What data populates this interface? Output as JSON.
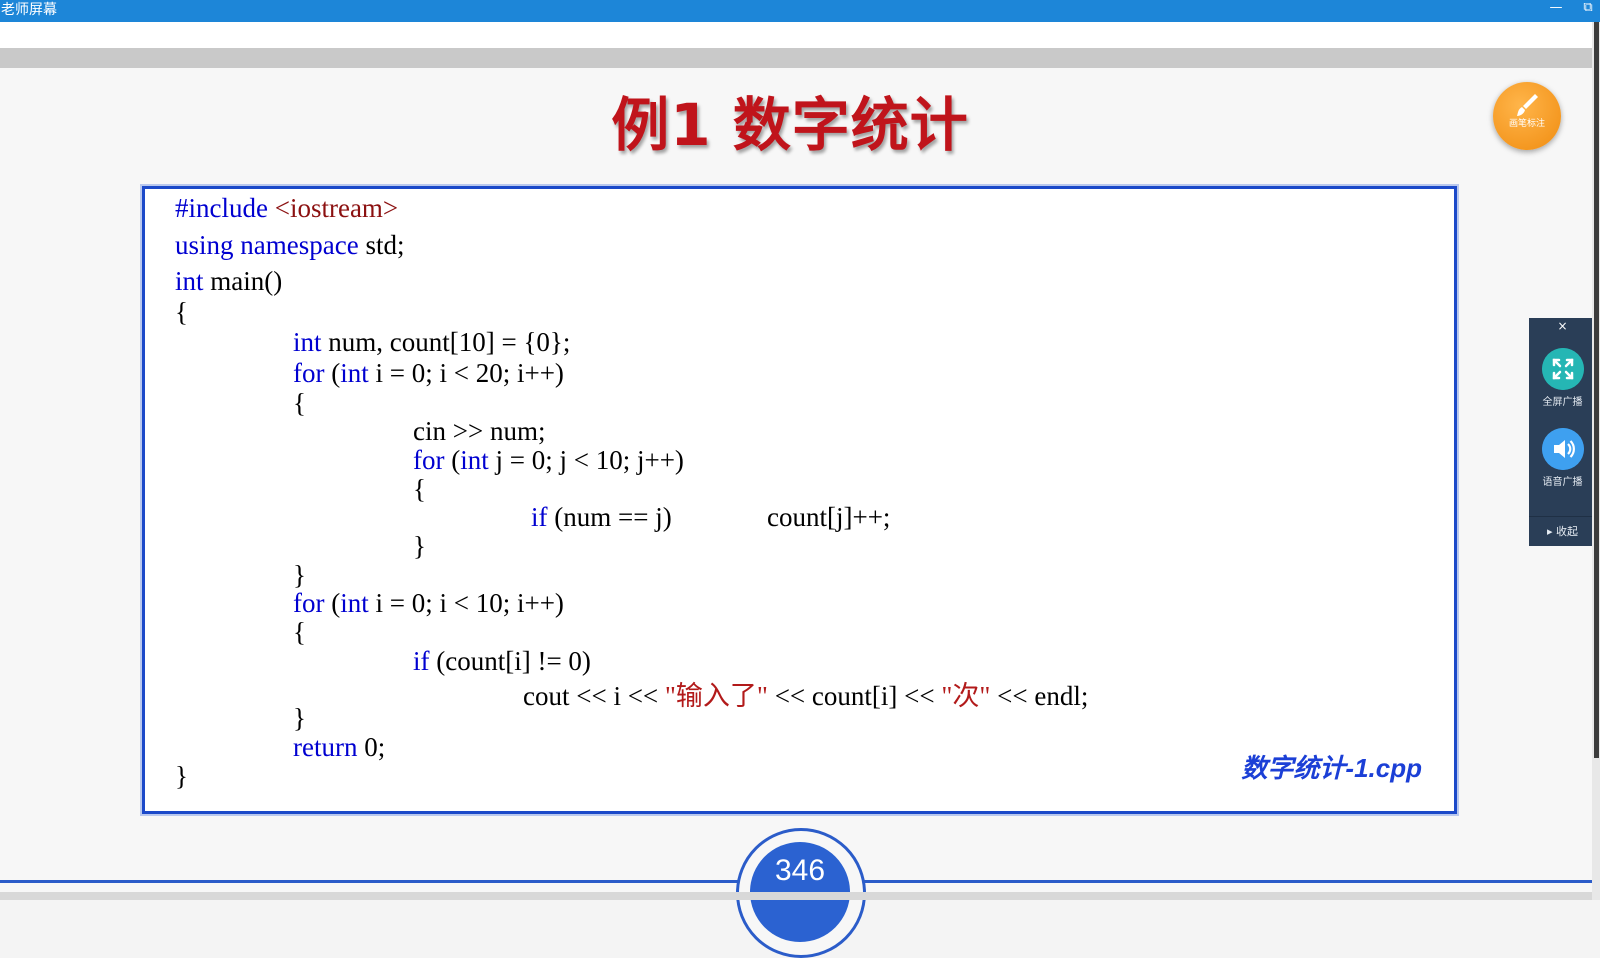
{
  "window": {
    "title": "老师屏幕",
    "minimize": "—",
    "restore": "⧉"
  },
  "slide": {
    "title": "例1 数字统计",
    "filename": "数字统计-1.cpp",
    "page_number": "346",
    "code": {
      "l1_inc": "#include",
      "l1_lib": " <iostream>",
      "l2_kw": "using namespace",
      "l2_rest": " std;",
      "l3_kw": "int",
      "l3_rest": " main()",
      "l4": "{",
      "l5_kw": "int",
      "l5_rest": " num, count[10] = {0};",
      "l6_kw1": "for",
      "l6_a": " (",
      "l6_kw2": "int",
      "l6_b": " i = 0; i < 20; i++)",
      "l7": "{",
      "l8": "cin >> num;",
      "l9_kw1": "for",
      "l9_a": " (",
      "l9_kw2": "int",
      "l9_b": " j = 0; j < 10; j++)",
      "l10": "{",
      "l11_kw": "if",
      "l11_a": " (num == j)",
      "l11_b": "count[j]++;",
      "l12": "}",
      "l13": "}",
      "l14_kw1": "for",
      "l14_a": " (",
      "l14_kw2": "int",
      "l14_b": " i = 0; i < 10; i++)",
      "l15": "{",
      "l16_kw": "if",
      "l16_rest": " (count[i] != 0)",
      "l17_a": "cout << i << ",
      "l17_str1": "\"输入了\"",
      "l17_b": " << count[i] << ",
      "l17_str2": "\"次\"",
      "l17_c": " << endl;",
      "l18": "}",
      "l19_kw": "return",
      "l19_rest": " 0;",
      "l20": "}"
    }
  },
  "pen_button": {
    "label": "画笔标注",
    "icon": "brush-icon"
  },
  "side_panel": {
    "close": "×",
    "fullscreen_label": "全屏广播",
    "voice_label": "语音广播",
    "collapse_label": "▸ 收起"
  },
  "colors": {
    "titlebar": "#1d86d8",
    "title_red": "#c0141b",
    "keyword_blue": "#0000d0",
    "code_border": "#1b49c9",
    "pen_orange": "#f08c10",
    "panel_bg": "#2a3e57"
  }
}
